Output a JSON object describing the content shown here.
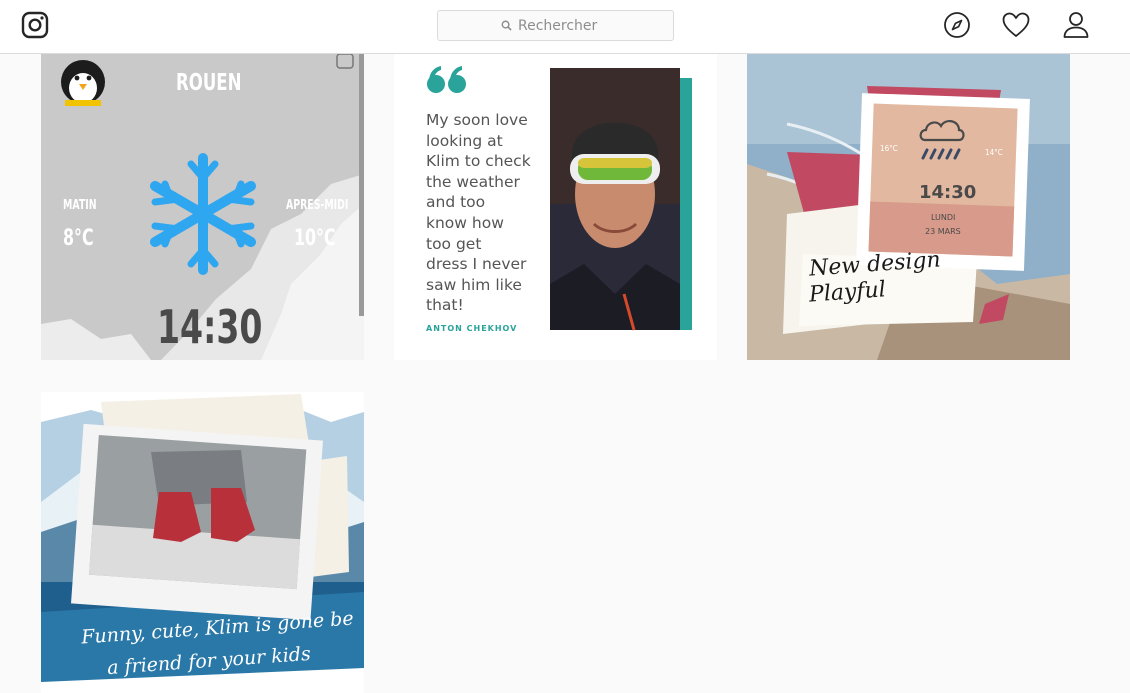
{
  "header": {
    "search_placeholder": "Rechercher"
  },
  "icons": {
    "logo": "instagram-logo",
    "explore": "compass-icon",
    "activity": "heart-icon",
    "profile": "user-icon",
    "search": "search-icon"
  },
  "posts": [
    {
      "city": "ROUEN",
      "label_morning": "MATIN",
      "label_afternoon": "APRES-MIDI",
      "temp_morning": "8°C",
      "temp_afternoon": "10°C",
      "time": "14:30"
    },
    {
      "quote_lines": [
        "My soon love",
        "looking at",
        "Klim to check",
        "the weather",
        "and too",
        "know how",
        "too get",
        "dress I never",
        "saw him like",
        "that!"
      ],
      "author": "ANTON CHEKHOV"
    },
    {
      "temp_left": "16°C",
      "temp_right": "14°C",
      "time": "14:30",
      "day": "LUNDI",
      "date": "23 MARS",
      "caption_line1": "New design",
      "caption_line2": "Playful"
    },
    {
      "caption_line1": "Funny, cute, Klim is gone be",
      "caption_line2": "a friend for your kids"
    }
  ],
  "colors": {
    "accent_teal": "#2aa39a",
    "snow_blue": "#2fa6f0",
    "border": "#dbdbdb"
  }
}
